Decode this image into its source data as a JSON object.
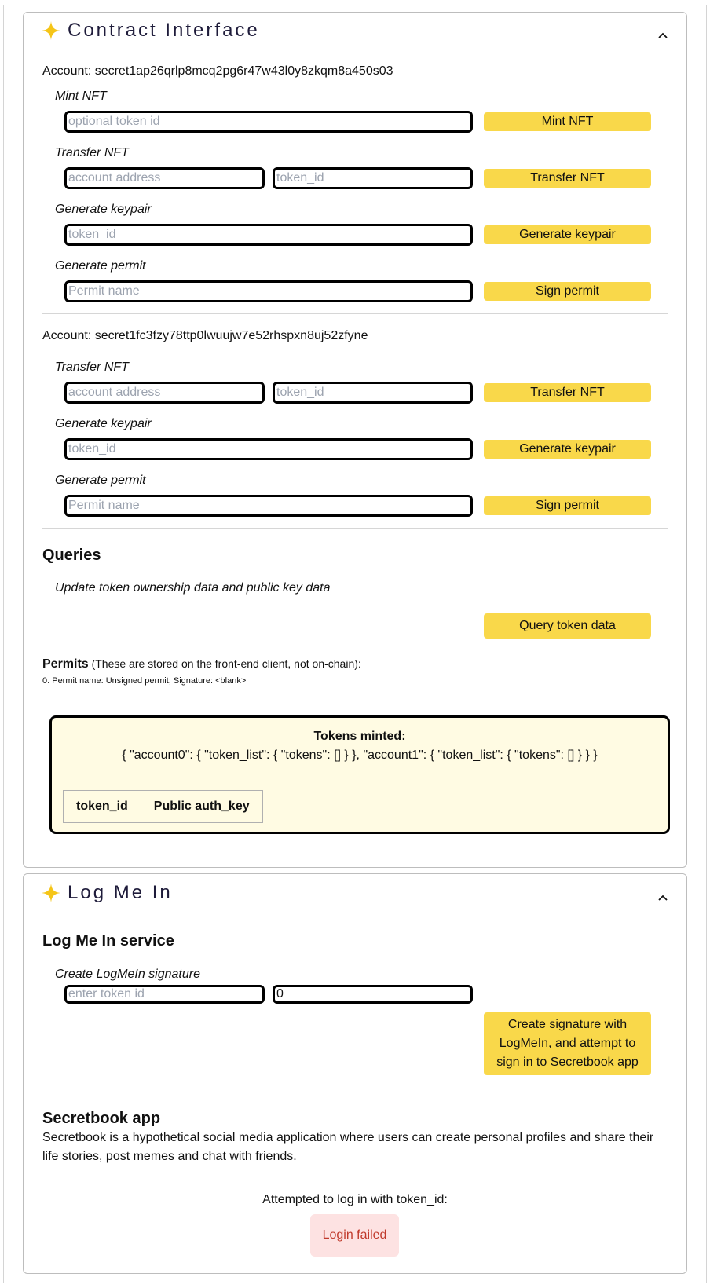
{
  "contract": {
    "title": "Contract Interface",
    "account0": {
      "label": "Account: secret1ap26qrlp8mcq2pg6r47w43l0y8zkqm8a450s03",
      "mint": {
        "label": "Mint NFT",
        "placeholder": "optional token id",
        "button": "Mint NFT"
      },
      "transfer": {
        "label": "Transfer NFT",
        "address_placeholder": "account address",
        "token_placeholder": "token_id",
        "button": "Transfer NFT"
      },
      "keypair": {
        "label": "Generate keypair",
        "placeholder": "token_id",
        "button": "Generate keypair"
      },
      "permit": {
        "label": "Generate permit",
        "placeholder": "Permit name",
        "button": "Sign permit"
      }
    },
    "account1": {
      "label": "Account: secret1fc3fzy78ttp0lwuujw7e52rhspxn8uj52zfyne",
      "transfer": {
        "label": "Transfer NFT",
        "address_placeholder": "account address",
        "token_placeholder": "token_id",
        "button": "Transfer NFT"
      },
      "keypair": {
        "label": "Generate keypair",
        "placeholder": "token_id",
        "button": "Generate keypair"
      },
      "permit": {
        "label": "Generate permit",
        "placeholder": "Permit name",
        "button": "Sign permit"
      }
    },
    "queries": {
      "heading": "Queries",
      "description": "Update token ownership data and public key data",
      "button": "Query token data"
    },
    "permits": {
      "heading": "Permits",
      "note": "(These are stored on the front-end client, not on-chain):",
      "items": [
        "0. Permit name: Unsigned permit; Signature: <blank>"
      ]
    },
    "tokens": {
      "heading": "Tokens minted:",
      "json": "{ \"account0\": { \"token_list\": { \"tokens\": [] } }, \"account1\": { \"token_list\": { \"tokens\": [] } } }",
      "columns": [
        "token_id",
        "Public auth_key"
      ]
    }
  },
  "logmein": {
    "title": "Log Me In",
    "service_heading": "Log Me In service",
    "create_label": "Create LogMeIn signature",
    "token_placeholder": "enter token id",
    "second_value": "0",
    "button": "Create signature with LogMeIn, and attempt to sign in to Secretbook app",
    "secretbook": {
      "heading": "Secretbook app",
      "description": "Secretbook is a hypothetical social media application where users can create personal profiles and share their life stories, post memes and chat with friends.",
      "attempt_text": "Attempted to log in with token_id:",
      "status": "Login failed"
    }
  },
  "colors": {
    "button_bg": "#f9d84a",
    "star": "#f5c518",
    "tokens_bg": "#fffbe3",
    "error_bg": "#fde2e2",
    "error_text": "#c0392b"
  }
}
